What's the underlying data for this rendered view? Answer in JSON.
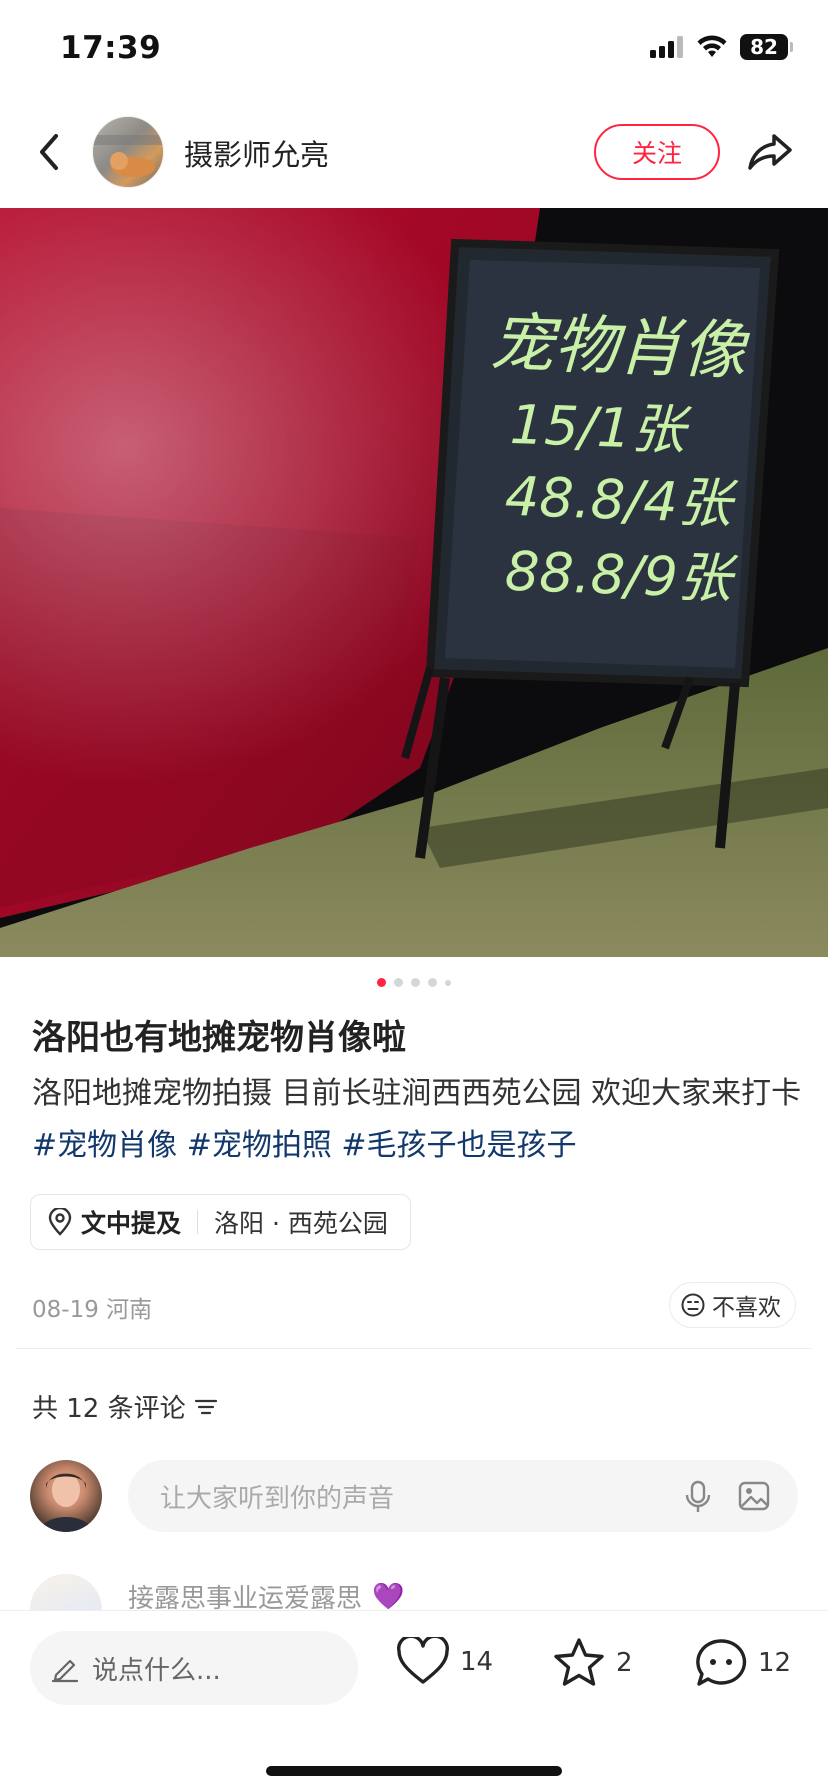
{
  "status_bar": {
    "time": "17:39",
    "battery": "82",
    "icons": [
      "signal-icon",
      "wifi-icon",
      "battery-icon"
    ]
  },
  "nav": {
    "author_name": "摄影师允亮",
    "follow_label": "关注",
    "icons": [
      "back-icon",
      "share-icon"
    ]
  },
  "photo": {
    "board_lines": [
      "宠物肖像",
      "15/1张",
      "48.8/4张",
      "88.8/9张"
    ],
    "carousel_total": 5,
    "carousel_index": 1
  },
  "post": {
    "title": "洛阳也有地摊宠物肖像啦",
    "body_text": "洛阳地摊宠物拍摄 目前长驻涧西西苑公园 欢迎大家来打卡",
    "tags": [
      "#宠物肖像",
      "#宠物拍照",
      "#毛孩子也是孩子"
    ],
    "location_label": "文中提及",
    "location_value": "洛阳 · 西苑公园",
    "date": "08-19 河南",
    "dislike_label": "不喜欢"
  },
  "comments": {
    "count_text": "共 12 条评论",
    "input_placeholder": "让大家听到你的声音",
    "first_comment_name": "接露思事业运爱露思",
    "first_comment_emoji": "💜"
  },
  "bottom_bar": {
    "say_placeholder": "说点什么...",
    "likes": "14",
    "stars": "2",
    "comments": "12"
  },
  "colors": {
    "brand_red": "#ff2442",
    "tag_blue": "#13386c",
    "chalk_green": "#c8f0a6"
  }
}
